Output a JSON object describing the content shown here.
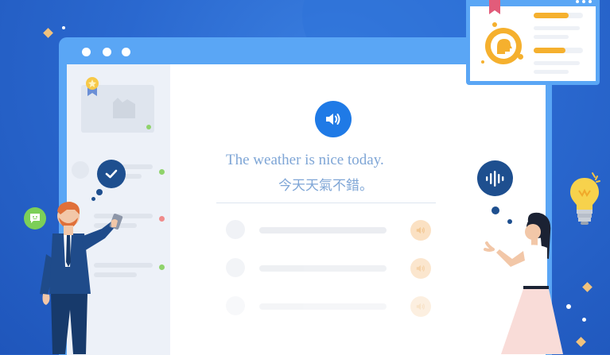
{
  "lesson": {
    "sentence_en": "The weather is nice today.",
    "sentence_zh": "今天天氣不錯。"
  },
  "colors": {
    "background": "#2a68cf",
    "window_frame": "#5aa6f5",
    "speaker_accent": "#1f7ae6",
    "text": "#7fa6d6",
    "bubble_dark": "#1e4f8f",
    "status_green": "#8fd36b",
    "status_red": "#f08b8b",
    "orange_accent": "#f5b02e"
  },
  "icons": {
    "play": "speaker-icon",
    "check": "check-icon",
    "voice": "voice-wave-icon",
    "idea": "lightbulb-icon",
    "chat": "chat-icon"
  }
}
